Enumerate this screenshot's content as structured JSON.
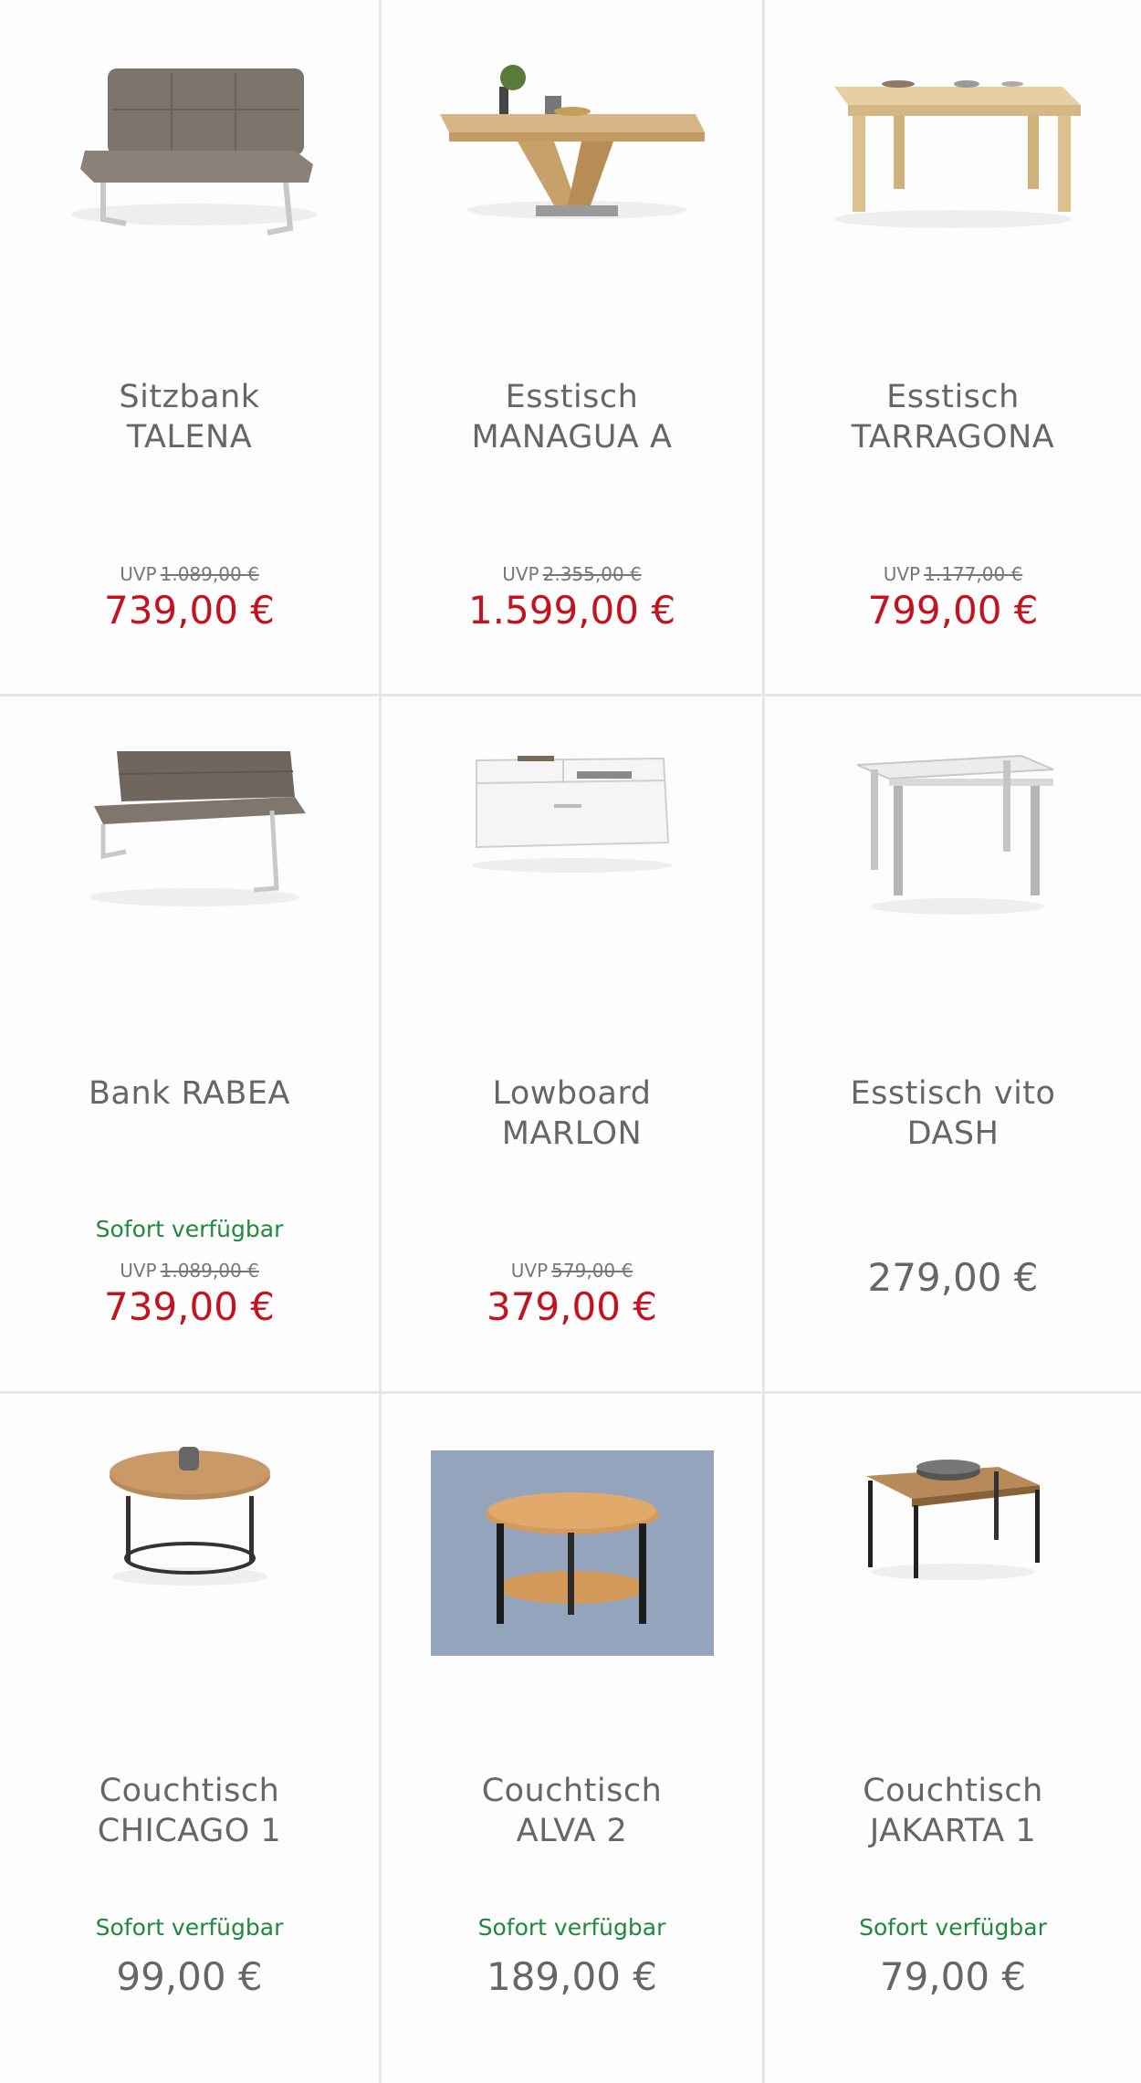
{
  "products": [
    {
      "line1": "Sitzbank",
      "line2": "TALENA",
      "availability": "",
      "uvp_label": "UVP",
      "uvp_price": "1.089,00 €",
      "price": "739,00 €",
      "image_icon": "bench-icon"
    },
    {
      "line1": "Esstisch",
      "line2": "MANAGUA A",
      "availability": "",
      "uvp_label": "UVP",
      "uvp_price": "2.355,00 €",
      "price": "1.599,00 €",
      "image_icon": "dining-table-icon"
    },
    {
      "line1": "Esstisch",
      "line2": "TARRAGONA",
      "availability": "",
      "uvp_label": "UVP",
      "uvp_price": "1.177,00 €",
      "price": "799,00 €",
      "image_icon": "dining-table-icon"
    },
    {
      "line1": "Bank RABEA",
      "line2": "",
      "availability": "Sofort verfügbar",
      "uvp_label": "UVP",
      "uvp_price": "1.089,00 €",
      "price": "739,00 €",
      "image_icon": "bench-icon"
    },
    {
      "line1": "Lowboard",
      "line2": "MARLON",
      "availability": "",
      "uvp_label": "UVP",
      "uvp_price": "579,00 €",
      "price": "379,00 €",
      "image_icon": "lowboard-icon"
    },
    {
      "line1": "Esstisch vito",
      "line2": "DASH",
      "availability": "",
      "uvp_label": "",
      "uvp_price": "",
      "price": "279,00 €",
      "image_icon": "dining-table-icon"
    },
    {
      "line1": "Couchtisch",
      "line2": "CHICAGO 1",
      "availability": "Sofort verfügbar",
      "uvp_label": "",
      "uvp_price": "",
      "price": "99,00 €",
      "image_icon": "coffee-table-icon"
    },
    {
      "line1": "Couchtisch",
      "line2": "ALVA 2",
      "availability": "Sofort verfügbar",
      "uvp_label": "",
      "uvp_price": "",
      "price": "189,00 €",
      "image_icon": "coffee-table-icon"
    },
    {
      "line1": "Couchtisch",
      "line2": "JAKARTA 1",
      "availability": "Sofort verfügbar",
      "uvp_label": "",
      "uvp_price": "",
      "price": "79,00 €",
      "image_icon": "coffee-table-icon"
    }
  ],
  "colors": {
    "sale_price": "#c4121f",
    "normal_price": "#666666",
    "availability": "#1f8a3c",
    "divider": "#e6e6e6"
  }
}
